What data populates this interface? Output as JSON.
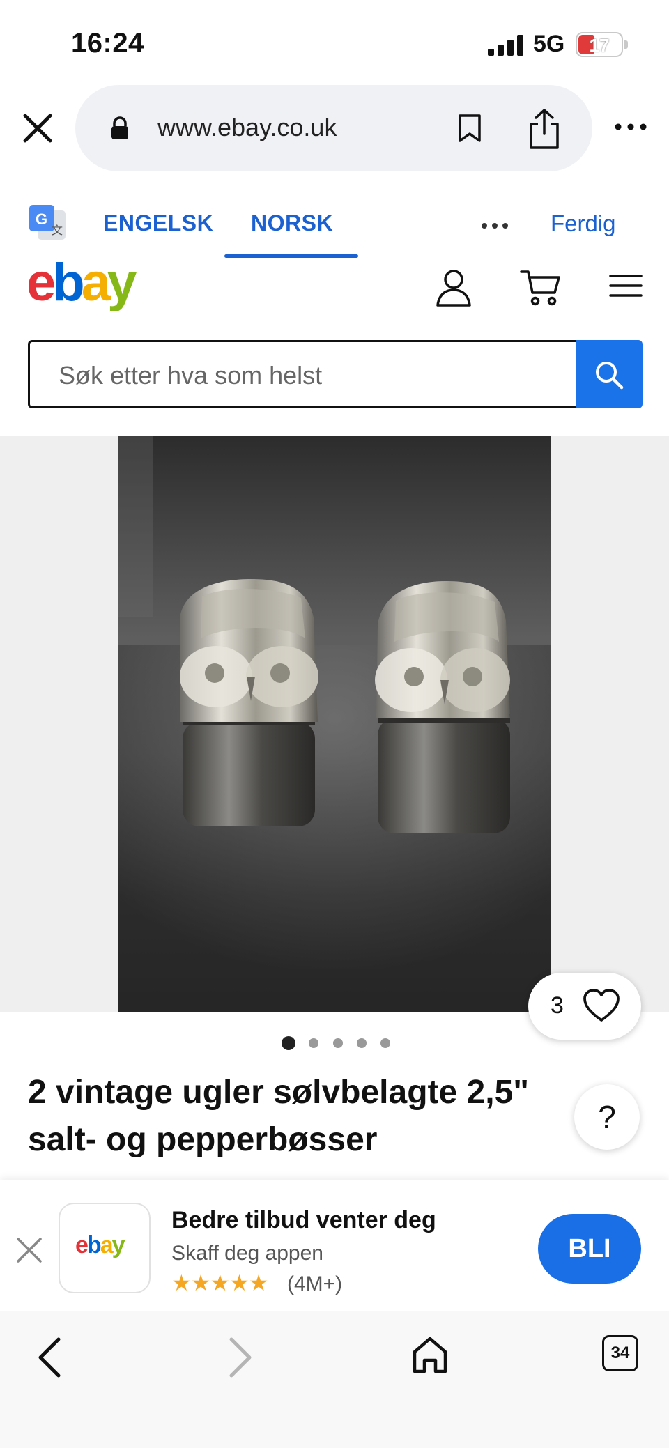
{
  "status_bar": {
    "time": "16:24",
    "network": "5G",
    "battery": "17"
  },
  "browser": {
    "url": "www.ebay.co.uk",
    "tab_count": "34"
  },
  "translate": {
    "lang_from": "ENGELSK",
    "lang_to": "NORSK",
    "done_label": "Ferdig"
  },
  "header": {
    "logo_letters": [
      "e",
      "b",
      "a",
      "y"
    ],
    "logo_colors": [
      "#e53238",
      "#0064d2",
      "#f5af02",
      "#86b817"
    ]
  },
  "search": {
    "placeholder": "Søk etter hva som helst"
  },
  "listing": {
    "favorite_count": "3",
    "image_count": 5,
    "current_image": 1,
    "title": "2 vintage ugler sølvbelagte 2,5\" salt- og pepperbøsser",
    "help_label": "?"
  },
  "app_banner": {
    "app_name": "ebay",
    "title": "Bedre tilbud venter deg",
    "subtitle": "Skaff deg appen",
    "stars": "★★★★★",
    "rating_count": "(4M+)",
    "cta": "BLI"
  },
  "icons": {
    "close": "close-icon",
    "lock": "lock-icon",
    "bookmark": "bookmark-icon",
    "share": "share-icon",
    "more": "more-icon",
    "translate": "google-translate-icon",
    "user": "user-icon",
    "cart": "cart-icon",
    "menu": "hamburger-menu-icon",
    "search": "search-icon",
    "heart": "heart-icon",
    "back": "chevron-left-icon",
    "forward": "chevron-right-icon",
    "home": "home-icon",
    "tabs": "tabs-icon"
  }
}
